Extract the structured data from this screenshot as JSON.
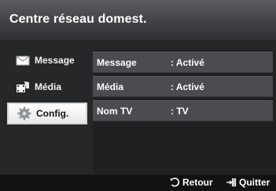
{
  "header": {
    "title": "Centre réseau domest."
  },
  "sidebar": {
    "items": [
      {
        "label": "Message",
        "icon": "envelope-icon",
        "selected": false
      },
      {
        "label": "Média",
        "icon": "media-film-icon",
        "selected": false
      },
      {
        "label": "Config.",
        "icon": "gear-icon",
        "selected": true
      }
    ]
  },
  "settings": {
    "rows": [
      {
        "label": "Message",
        "value": ": Activé"
      },
      {
        "label": "Média",
        "value": ": Activé"
      },
      {
        "label": "Nom TV",
        "value": ": TV"
      }
    ]
  },
  "footer": {
    "return_label": "Retour",
    "return_icon": "return-arrow-icon",
    "exit_label": "Quitter",
    "exit_icon": "exit-icon"
  },
  "colors": {
    "panel_background": "#262729",
    "header_gradient_top": "#5d5e61",
    "row_background": "#4b4c50",
    "selected_background": "#fefefe"
  }
}
